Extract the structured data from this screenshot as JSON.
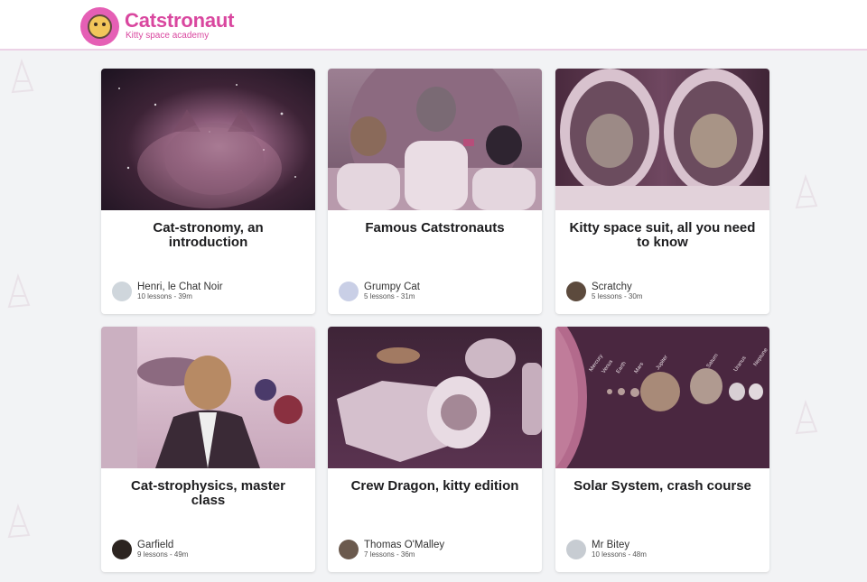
{
  "brand": {
    "title": "Catstronaut",
    "subtitle": "Kitty space academy",
    "color": "#d9479f"
  },
  "courses": [
    {
      "title": "Cat-stronomy, an introduction",
      "author": "Henri, le Chat Noir",
      "meta": "10 lessons - 39m",
      "avatar_color": "#cfd6dc"
    },
    {
      "title": "Famous Catstronauts",
      "author": "Grumpy Cat",
      "meta": "5 lessons - 31m",
      "avatar_color": "#c9cfe6"
    },
    {
      "title": "Kitty space suit, all you need to know",
      "author": "Scratchy",
      "meta": "5 lessons - 30m",
      "avatar_color": "#5c4a3d"
    },
    {
      "title": "Cat-strophysics, master class",
      "author": "Garfield",
      "meta": "9 lessons - 49m",
      "avatar_color": "#2c2420"
    },
    {
      "title": "Crew Dragon, kitty edition",
      "author": "Thomas O'Malley",
      "meta": "7 lessons - 36m",
      "avatar_color": "#6b5a4e"
    },
    {
      "title": "Solar System, crash course",
      "author": "Mr Bitey",
      "meta": "10 lessons - 48m",
      "avatar_color": "#c7ccd2"
    }
  ],
  "planets": [
    "Mercury",
    "Venus",
    "Earth",
    "Mars",
    "Jupiter",
    "Saturn",
    "Uranus",
    "Neptune"
  ]
}
